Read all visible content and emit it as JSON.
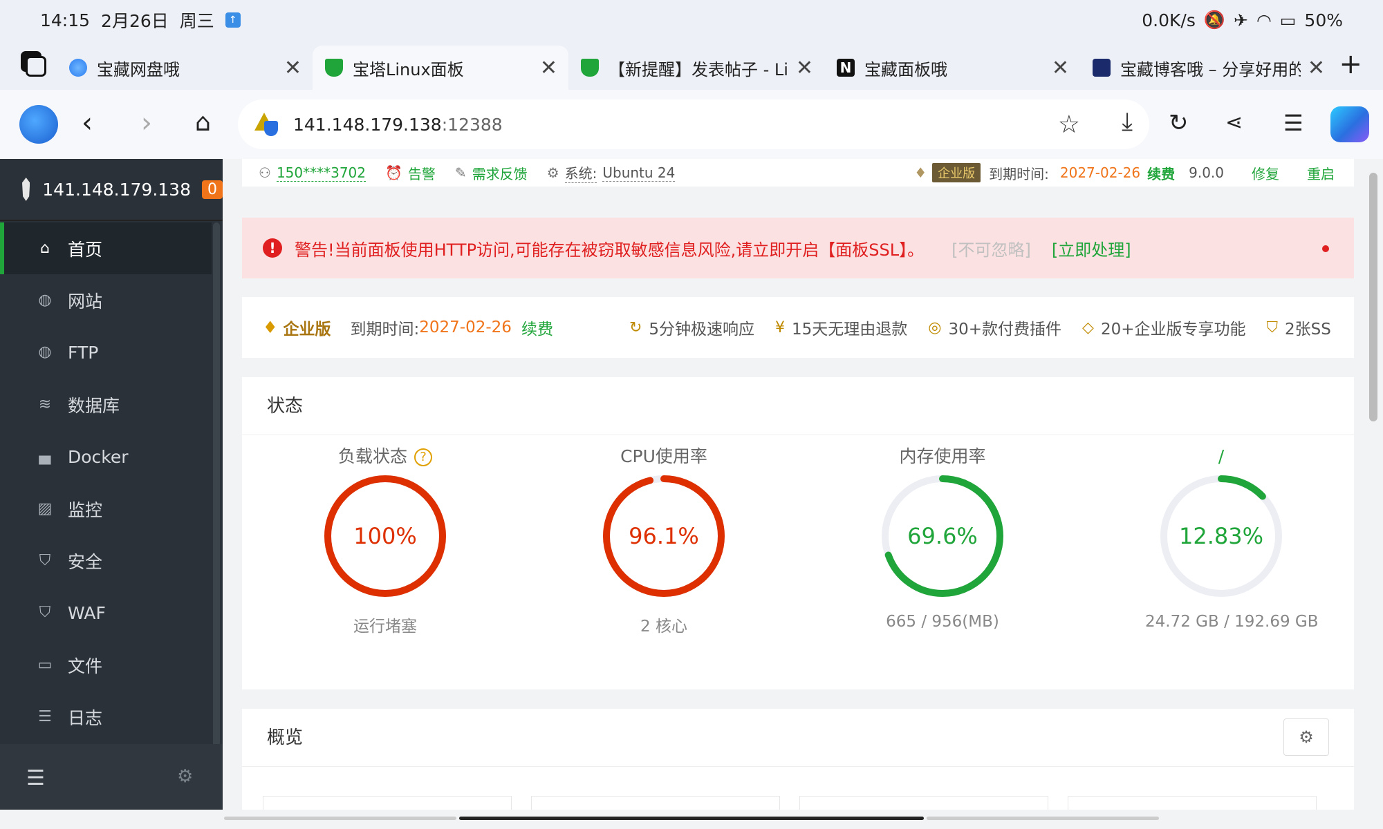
{
  "status_bar": {
    "time": "14:15",
    "date": "2月26日",
    "weekday": "周三",
    "right_text": "0.0K/s",
    "battery": "50%"
  },
  "tabs": [
    {
      "title": "宝藏网盘哦",
      "favicon_color": "#2a7cf0"
    },
    {
      "title": "宝塔Linux面板",
      "favicon_color": "#20a53a"
    },
    {
      "title": "【新提醒】发表帖子 - Li",
      "favicon_color": "#20a53a"
    },
    {
      "title": "宝藏面板哦",
      "favicon_color": "#111111"
    },
    {
      "title": "宝藏博客哦 – 分享好用的",
      "favicon_color": "#1b2a6b"
    }
  ],
  "address": {
    "host": "141.148.179.138",
    "port": ":12388"
  },
  "sidebar": {
    "server_ip": "141.148.179.138",
    "badge": "0",
    "items": [
      {
        "label": "首页",
        "icon": "home-icon"
      },
      {
        "label": "网站",
        "icon": "globe-icon"
      },
      {
        "label": "FTP",
        "icon": "ftp-icon"
      },
      {
        "label": "数据库",
        "icon": "database-icon"
      },
      {
        "label": "Docker",
        "icon": "docker-icon"
      },
      {
        "label": "监控",
        "icon": "monitor-icon"
      },
      {
        "label": "安全",
        "icon": "shield-icon"
      },
      {
        "label": "WAF",
        "icon": "waf-icon"
      },
      {
        "label": "文件",
        "icon": "folder-icon"
      },
      {
        "label": "日志",
        "icon": "log-icon"
      }
    ]
  },
  "top_info": {
    "user": "150****3702",
    "alarm": "告警",
    "feedback": "需求反馈",
    "system_label": "系统:",
    "system_value": "Ubuntu 24",
    "edition_tag": "企业版",
    "expire_label": "到期时间:",
    "expire_date": "2027-02-26",
    "renew": "续费",
    "version": "9.0.0",
    "repair": "修复",
    "restart": "重启"
  },
  "alert": {
    "message": "警告!当前面板使用HTTP访问,可能存在被窃取敏感信息风险,请立即开启【面板SSL】。",
    "ignore": "[不可忽略]",
    "handle": "[立即处理]"
  },
  "enterprise": {
    "name": "企业版",
    "expire_label": "到期时间:",
    "expire_date": "2027-02-26",
    "renew": "续费",
    "features": [
      "5分钟极速响应",
      "15天无理由退款",
      "30+款付费插件",
      "20+企业版专享功能",
      "2张SS"
    ]
  },
  "status_card": {
    "title": "状态",
    "gauges": [
      {
        "title": "负载状态",
        "value_text": "100%",
        "value": 100,
        "sub": "运行堵塞",
        "color": "#dd2f00",
        "help": "?"
      },
      {
        "title": "CPU使用率",
        "value_text": "96.1%",
        "value": 96.1,
        "sub": "2 核心",
        "color": "#dd2f00"
      },
      {
        "title": "内存使用率",
        "value_text": "69.6%",
        "value": 69.6,
        "sub": "665 / 956(MB)",
        "color": "#20a53a"
      },
      {
        "title": "/",
        "value_text": "12.83%",
        "value": 12.83,
        "sub": "24.72 GB / 192.69 GB",
        "color": "#20a53a"
      }
    ]
  },
  "overview_card": {
    "title": "概览"
  }
}
